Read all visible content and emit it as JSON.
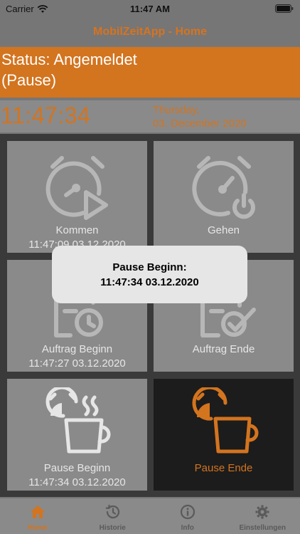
{
  "status_bar": {
    "carrier": "Carrier",
    "time": "11:47 AM"
  },
  "nav": {
    "title": "MobilZeitApp - Home"
  },
  "status": {
    "line1": "Status: Angemeldet",
    "line2": "(Pause)"
  },
  "clock": {
    "time": "11:47:34",
    "weekday": "Thursday,",
    "date": "03. December 2020"
  },
  "tiles": [
    {
      "label": "Kommen",
      "sub": "11:47:09 03.12.2020",
      "icon": "stopwatch-play-icon"
    },
    {
      "label": "Gehen",
      "sub": "",
      "icon": "stopwatch-power-icon"
    },
    {
      "label": "Auftrag Beginn",
      "sub": "11:47:27 03.12.2020",
      "icon": "clipboard-clock-icon"
    },
    {
      "label": "Auftrag Ende",
      "sub": "",
      "icon": "clipboard-check-icon"
    },
    {
      "label": "Pause Beginn",
      "sub": "11:47:34 03.12.2020",
      "icon": "timer-coffee-steam-icon"
    },
    {
      "label": "Pause Ende",
      "sub": "",
      "icon": "timer-coffee-icon"
    }
  ],
  "alert": {
    "title": "Pause Beginn:",
    "message": "11:47:34 03.12.2020"
  },
  "tabs": [
    {
      "label": "Home",
      "icon": "home-icon"
    },
    {
      "label": "Historie",
      "icon": "history-icon"
    },
    {
      "label": "Info",
      "icon": "info-icon"
    },
    {
      "label": "Einstellungen",
      "icon": "gear-icon"
    }
  ],
  "colors": {
    "accent": "#d3741f",
    "tile": "#8a8a8a",
    "active_tile": "#1c1c1c"
  }
}
